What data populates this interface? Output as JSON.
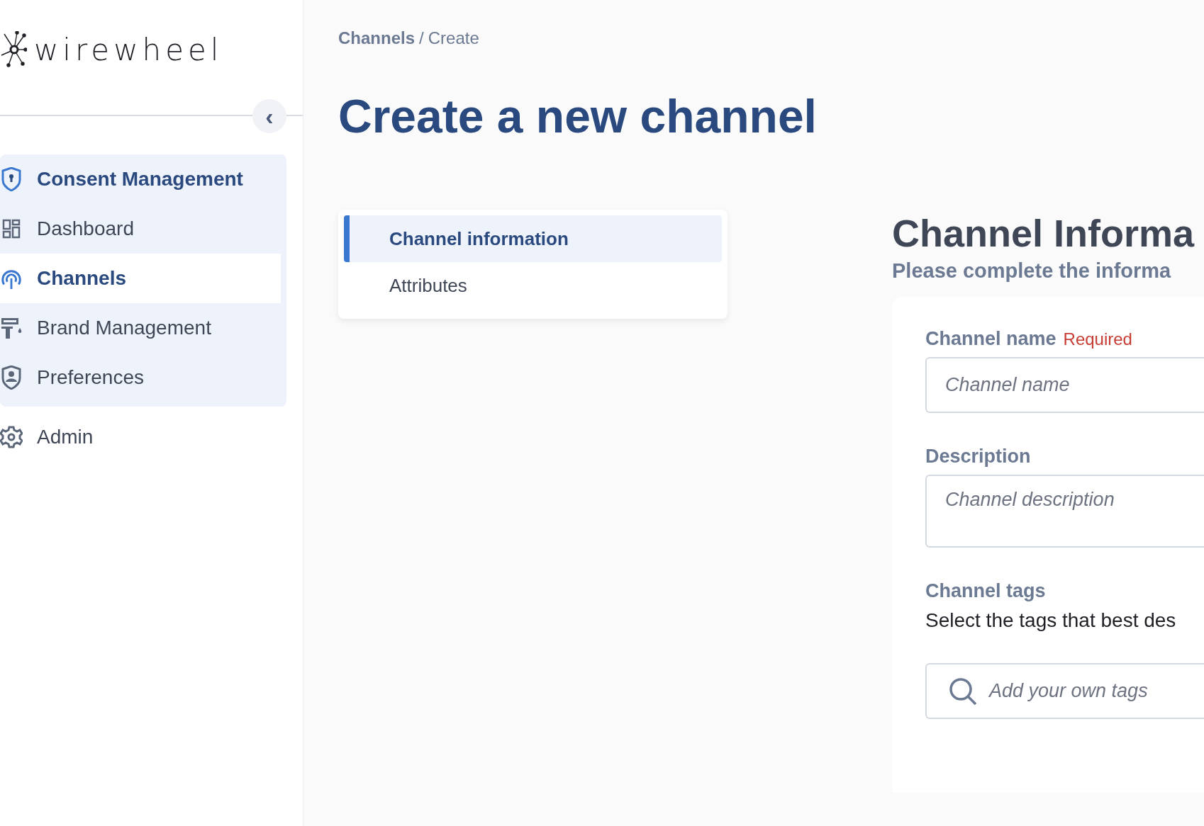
{
  "logo": {
    "text": "wirewheel"
  },
  "sidebar": {
    "collapse_icon": "‹",
    "items": [
      {
        "label": "Consent Management",
        "expanded": true,
        "selected": false,
        "children": [
          {
            "label": "Dashboard",
            "selected": false
          },
          {
            "label": "Channels",
            "selected": true
          },
          {
            "label": "Brand Management",
            "selected": false
          },
          {
            "label": "Preferences",
            "selected": false
          }
        ]
      },
      {
        "label": "Admin",
        "expanded": false,
        "selected": false
      }
    ]
  },
  "breadcrumb": {
    "items": [
      "Channels",
      "Create"
    ],
    "separator": "/"
  },
  "title": "Create a new channel",
  "steps": [
    {
      "label": "Channel information",
      "selected": true
    },
    {
      "label": "Attributes",
      "selected": false
    }
  ],
  "panel": {
    "title": "Channel Informa",
    "subtitle": "Please complete the informa",
    "fields": [
      {
        "kind": "input",
        "label": "Channel name",
        "required": "Required",
        "placeholder": "Channel name"
      },
      {
        "kind": "textarea",
        "label": "Description",
        "placeholder": "Channel description"
      },
      {
        "kind": "tags",
        "label": "Channel tags",
        "help": "Select the tags that best des",
        "placeholder": "Add your own tags"
      }
    ]
  }
}
